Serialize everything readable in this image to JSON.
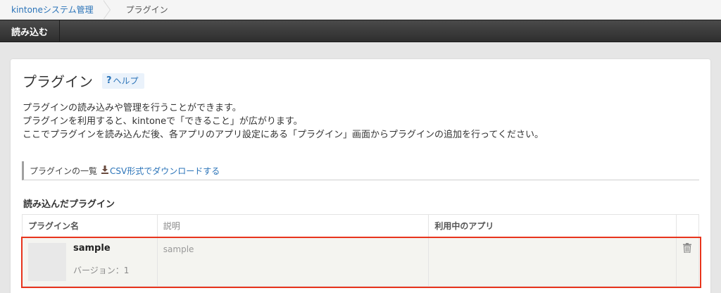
{
  "breadcrumb": {
    "root": "kintoneシステム管理",
    "current": "プラグイン"
  },
  "toolbar": {
    "import_label": "読み込む"
  },
  "page": {
    "title": "プラグイン",
    "help_label": "ヘルプ",
    "help_icon": "?",
    "description": [
      "プラグインの読み込みや管理を行うことができます。",
      "プラグインを利用すると、kintoneで「できること」が広がります。",
      "ここでプラグインを読み込んだ後、各アプリのアプリ設定にある「プラグイン」画面からプラグインの追加を行ってください。"
    ],
    "list_label": "プラグインの一覧",
    "csv_link": "CSV形式でダウンロードする"
  },
  "section": {
    "title": "読み込んだプラグイン"
  },
  "table": {
    "headers": [
      "プラグイン名",
      "説明",
      "利用中のアプリ"
    ],
    "rows": [
      {
        "name": "sample",
        "version": "バージョン：1",
        "description": "sample",
        "apps": ""
      }
    ]
  },
  "colors": {
    "link": "#2a73b8",
    "toolbar": "#333333",
    "highlight": "#e8341c",
    "row_background": "#f4f4f0"
  },
  "icons": {
    "help": "help-icon",
    "download": "download-icon",
    "delete": "trash-icon"
  }
}
